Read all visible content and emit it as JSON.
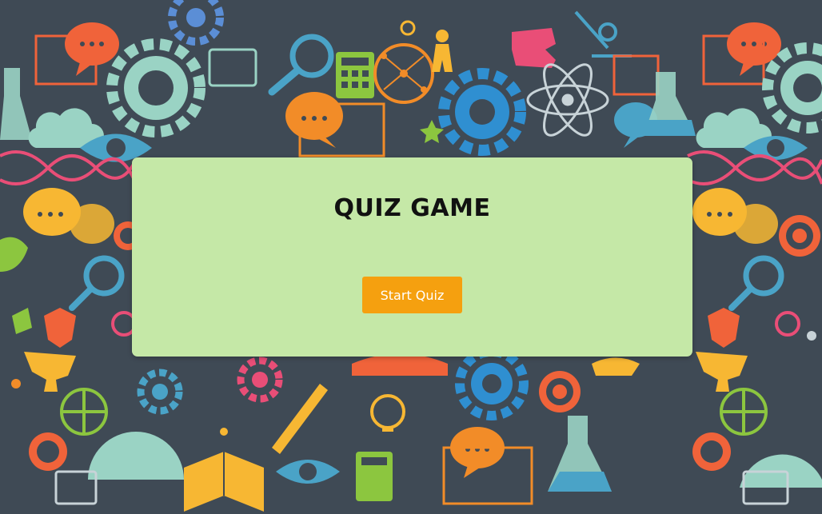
{
  "background": {
    "theme": "science-education-doodles",
    "base_color": "#3f4a55",
    "icons": [
      "gear-icon",
      "speech-bubble-icon",
      "atom-icon",
      "dna-icon",
      "eye-icon",
      "magnifier-icon",
      "flask-icon",
      "calculator-icon",
      "globe-icon",
      "target-icon",
      "puzzle-icon",
      "book-icon",
      "cloud-icon",
      "lightbulb-icon",
      "protractor-icon",
      "person-icon"
    ],
    "palette": [
      "#f28c28",
      "#4aa3c7",
      "#e94e77",
      "#8cc63f",
      "#f7b733",
      "#9ad3c4",
      "#7d8c97"
    ]
  },
  "quiz": {
    "title": "QUIZ GAME",
    "start_label": "Start Quiz",
    "card_color": "#c5e8a7",
    "button_color": "#f5a00f"
  }
}
